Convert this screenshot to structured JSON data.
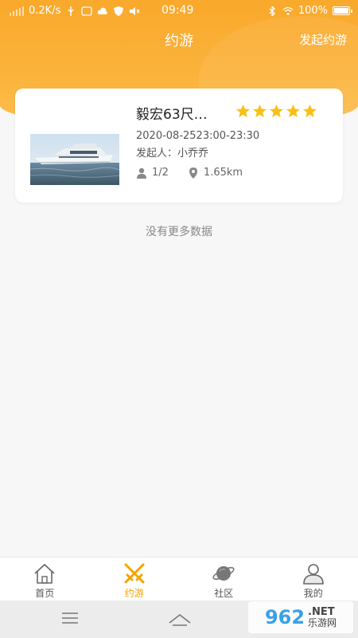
{
  "status_bar": {
    "net_speed": "0.2K/s",
    "time": "09:49",
    "battery": "100%"
  },
  "header": {
    "title": "约游",
    "action_label": "发起约游"
  },
  "trip_card": {
    "title": "毅宏63尺…",
    "rating": 5,
    "max_rating": 5,
    "time_range": "2020-08-2523:00-23:30",
    "initiator": "发起人：小乔乔",
    "participants": "1/2",
    "distance": "1.65km",
    "star_color": "#f8c11a"
  },
  "list_end_text": "没有更多数据",
  "tabbar": {
    "items": [
      {
        "label": "首页",
        "icon": "home-icon",
        "active": false
      },
      {
        "label": "约游",
        "icon": "crossed-swords-icon",
        "active": true
      },
      {
        "label": "社区",
        "icon": "planet-icon",
        "active": false
      },
      {
        "label": "我的",
        "icon": "user-icon",
        "active": false
      }
    ],
    "active_color": "#f5a300"
  },
  "watermark": {
    "number": "962",
    "net": ".NET",
    "cn": "乐游网"
  }
}
